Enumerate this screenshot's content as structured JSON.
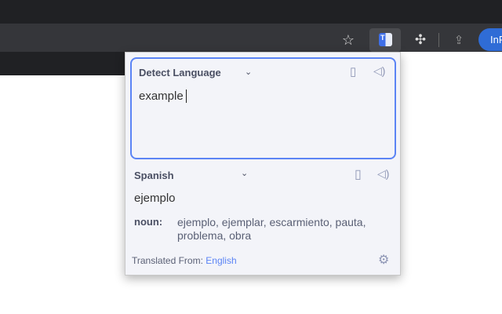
{
  "browser": {
    "profile_button": "InP"
  },
  "popup": {
    "source": {
      "language": "Detect Language",
      "text": "example"
    },
    "target": {
      "language": "Spanish",
      "text": "ejemplo"
    },
    "definitions": [
      {
        "pos": "noun:",
        "synonyms": "ejemplo, ejemplar, escarmiento, pauta, problema, obra"
      }
    ],
    "footer": {
      "label": "Translated From:",
      "language": "English"
    }
  },
  "colors": {
    "accent": "#5b84f5"
  }
}
